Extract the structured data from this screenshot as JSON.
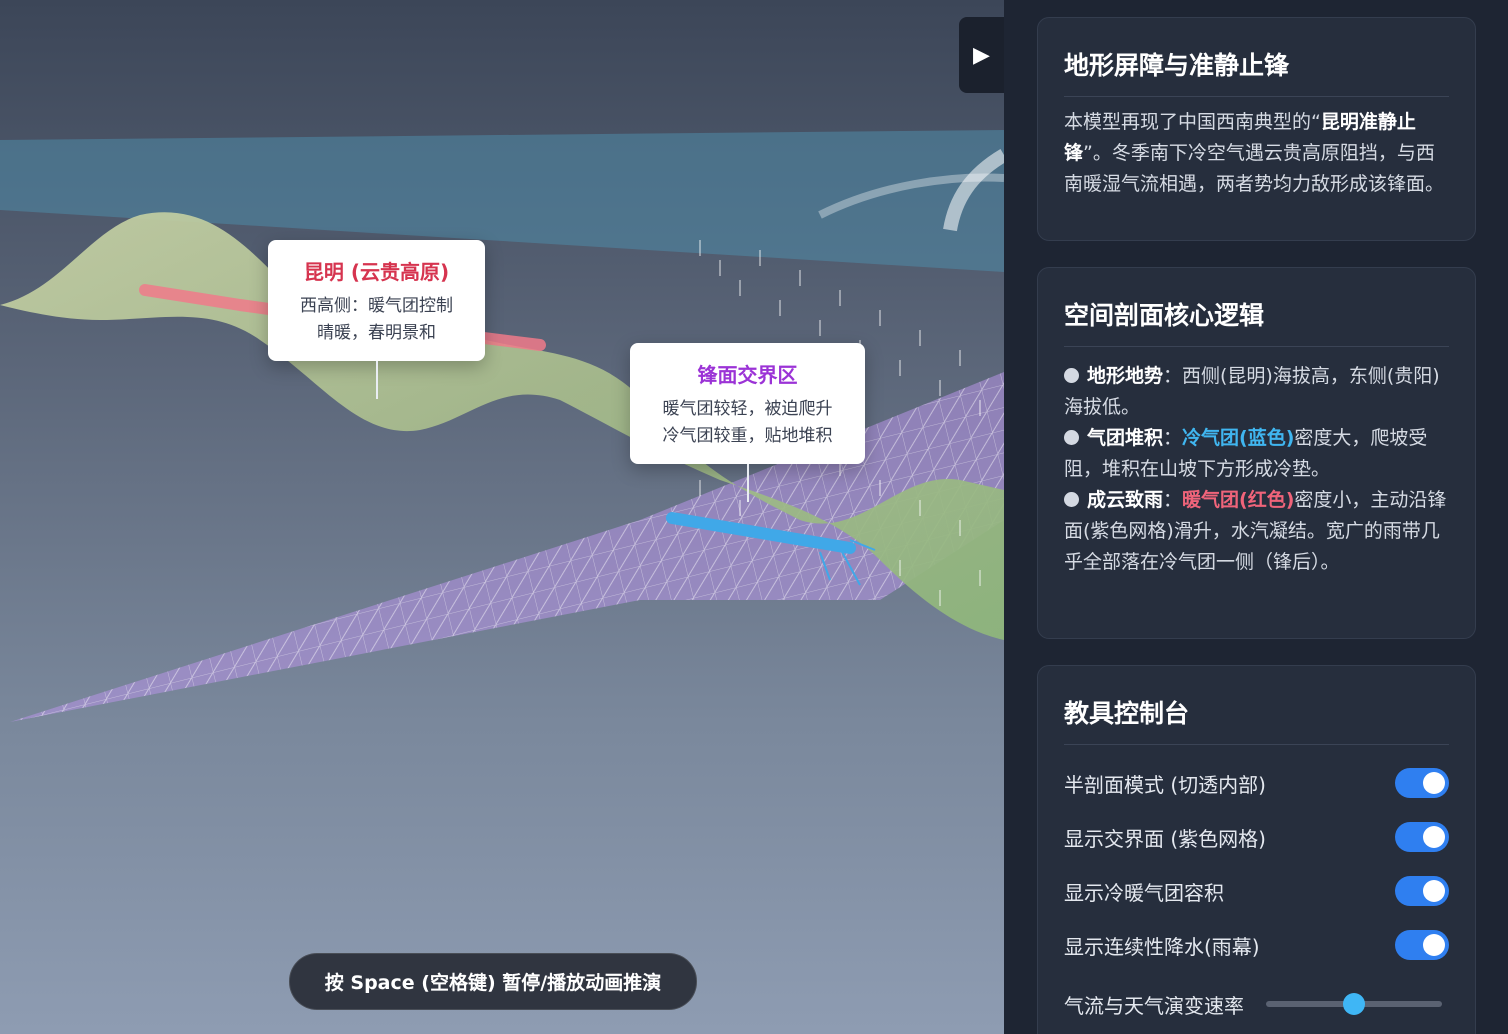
{
  "scene": {
    "play_icon": "play-triangle-icon",
    "hint": "按 Space (空格键) 暂停/播放动画推演",
    "labels": {
      "kunming": {
        "title": "昆明 (云贵高原)",
        "line1": "西高侧：暖气团控制",
        "line2": "晴暖，春明景和"
      },
      "front": {
        "title": "锋面交界区",
        "line1": "暖气团较轻，被迫爬升",
        "line2": "冷气团较重，贴地堆积"
      }
    },
    "colors": {
      "warm": "#f0647a",
      "cold": "#40b6f0",
      "front_mesh": "#c4a6ec",
      "terrain": "#b7c79a"
    }
  },
  "panel": {
    "card1": {
      "title": "地形屏障与准静止锋",
      "text_before": "本模型再现了中国西南典型的“",
      "text_bold": "昆明准静止锋",
      "text_after": "”。冬季南下冷空气遇云贵高原阻挡，与西南暖湿气流相遇，两者势均力敌形成该锋面。"
    },
    "card2": {
      "title": "空间剖面核心逻辑",
      "items": [
        {
          "heading": "地形地势",
          "text": "：西侧(昆明)海拔高，东侧(贵阳)海拔低。"
        },
        {
          "heading": "气团堆积",
          "highlight": "冷气团(蓝色)",
          "text": "密度大，爬坡受阻，堆积在山坡下方形成冷垫。"
        },
        {
          "heading": "成云致雨",
          "highlight": "暖气团(红色)",
          "text": "密度小，主动沿锋面(紫色网格)滑升，水汽凝结。宽广的雨带几乎全部落在冷气团一侧（锋后）。"
        }
      ]
    },
    "card3": {
      "title": "教具控制台",
      "toggles": [
        {
          "label": "半剖面模式 (切透内部)",
          "on": true
        },
        {
          "label": "显示交界面 (紫色网格)",
          "on": true
        },
        {
          "label": "显示冷暖气团容积",
          "on": true
        },
        {
          "label": "显示连续性降水(雨幕)",
          "on": true
        }
      ],
      "slider": {
        "label": "气流与天气演变速率",
        "value": 0.5
      }
    }
  }
}
